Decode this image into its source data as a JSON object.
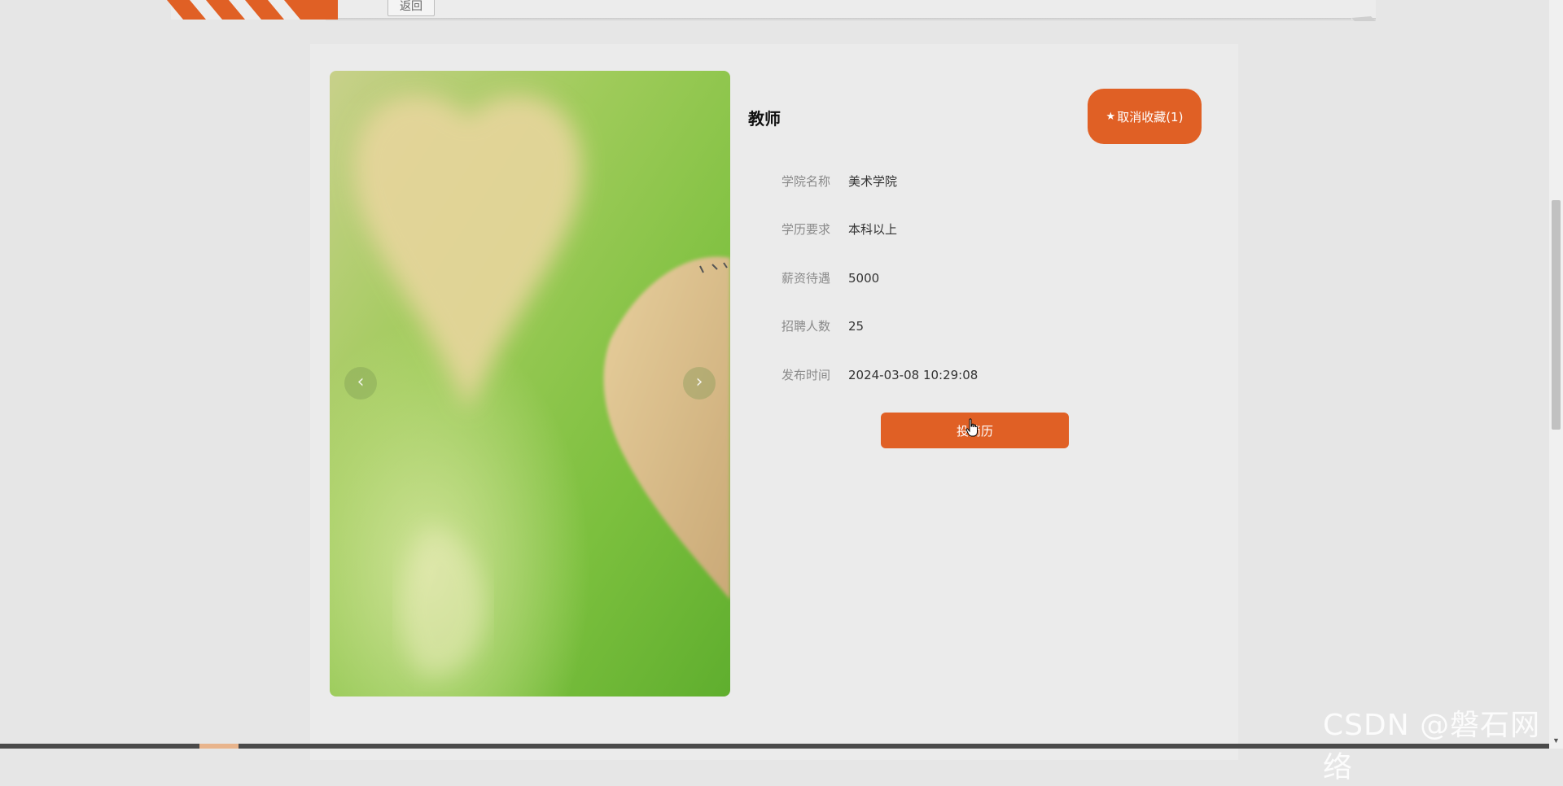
{
  "header": {
    "back_label": "返回"
  },
  "detail": {
    "title": "教师",
    "favorite_label": "取消收藏(1)",
    "favorite_icon": "star-icon",
    "fields": [
      {
        "label": "学院名称",
        "value": "美术学院"
      },
      {
        "label": "学历要求",
        "value": "本科以上"
      },
      {
        "label": "薪资待遇",
        "value": "5000"
      },
      {
        "label": "招聘人数",
        "value": "25"
      },
      {
        "label": "发布时间",
        "value": "2024-03-08 10:29:08"
      }
    ],
    "apply_label": "投简历"
  },
  "gallery": {
    "prev_icon": "‹",
    "next_icon": "›"
  },
  "watermark": "CSDN @磐石网络",
  "colors": {
    "accent": "#e06025",
    "background": "#e6e6e6",
    "card": "#ebebeb"
  }
}
